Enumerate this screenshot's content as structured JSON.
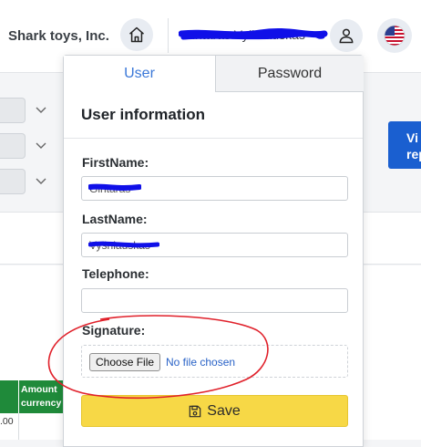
{
  "header": {
    "company": "Shark toys, Inc.",
    "username": "Gintaras Vyšniauskas",
    "icons": [
      "home-icon",
      "user-icon",
      "us-flag-icon"
    ]
  },
  "background": {
    "view_button_label": "Vi\nrep",
    "table": {
      "column_header": "Amount currency",
      "cell_value": ".00"
    }
  },
  "tabs": {
    "user": "User",
    "password": "Password",
    "active": "user"
  },
  "form": {
    "title": "User information",
    "first_name_label": "FirstName:",
    "first_name_value": "Gintaras",
    "last_name_label": "LastName:",
    "last_name_value": "Vyšniauskas",
    "telephone_label": "Telephone:",
    "telephone_value": "",
    "signature_label": "Signature:",
    "choose_file_label": "Choose File",
    "no_file_text": "No file chosen",
    "save_label": "Save",
    "save_icon": "floppy-disk-icon"
  },
  "colors": {
    "accent": "#3b78d8",
    "save_button": "#f7d846",
    "table_header": "#1f8a3a",
    "view_button": "#1a5fd0",
    "redaction": "#1010e8",
    "annotation_circle": "#e0202a"
  }
}
